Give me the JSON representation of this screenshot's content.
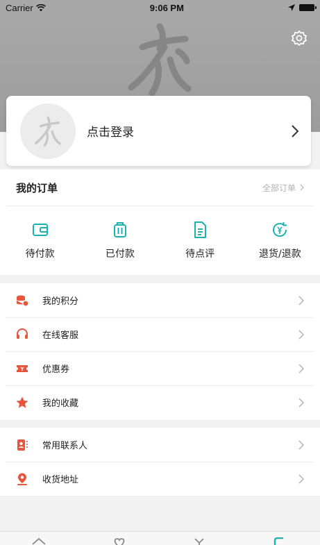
{
  "status_bar": {
    "carrier": "Carrier",
    "time": "9:06 PM"
  },
  "login": {
    "label": "点击登录"
  },
  "orders": {
    "title": "我的订单",
    "all_label": "全部订单",
    "items": [
      {
        "label": "待付款",
        "icon": "wallet-icon"
      },
      {
        "label": "已付款",
        "icon": "luggage-icon"
      },
      {
        "label": "待点评",
        "icon": "document-icon"
      },
      {
        "label": "退货/退款",
        "icon": "refund-icon"
      }
    ]
  },
  "menu_group_1": [
    {
      "label": "我的积分",
      "icon": "points-icon"
    },
    {
      "label": "在线客服",
      "icon": "headset-icon"
    },
    {
      "label": "优惠券",
      "icon": "coupon-icon"
    },
    {
      "label": "我的收藏",
      "icon": "star-icon"
    }
  ],
  "menu_group_2": [
    {
      "label": "常用联系人",
      "icon": "contacts-icon"
    },
    {
      "label": "收货地址",
      "icon": "location-icon"
    }
  ],
  "colors": {
    "accent_teal": "#1bb3b0",
    "accent_red": "#e8553d",
    "header_grey": "#a3a3a3"
  }
}
